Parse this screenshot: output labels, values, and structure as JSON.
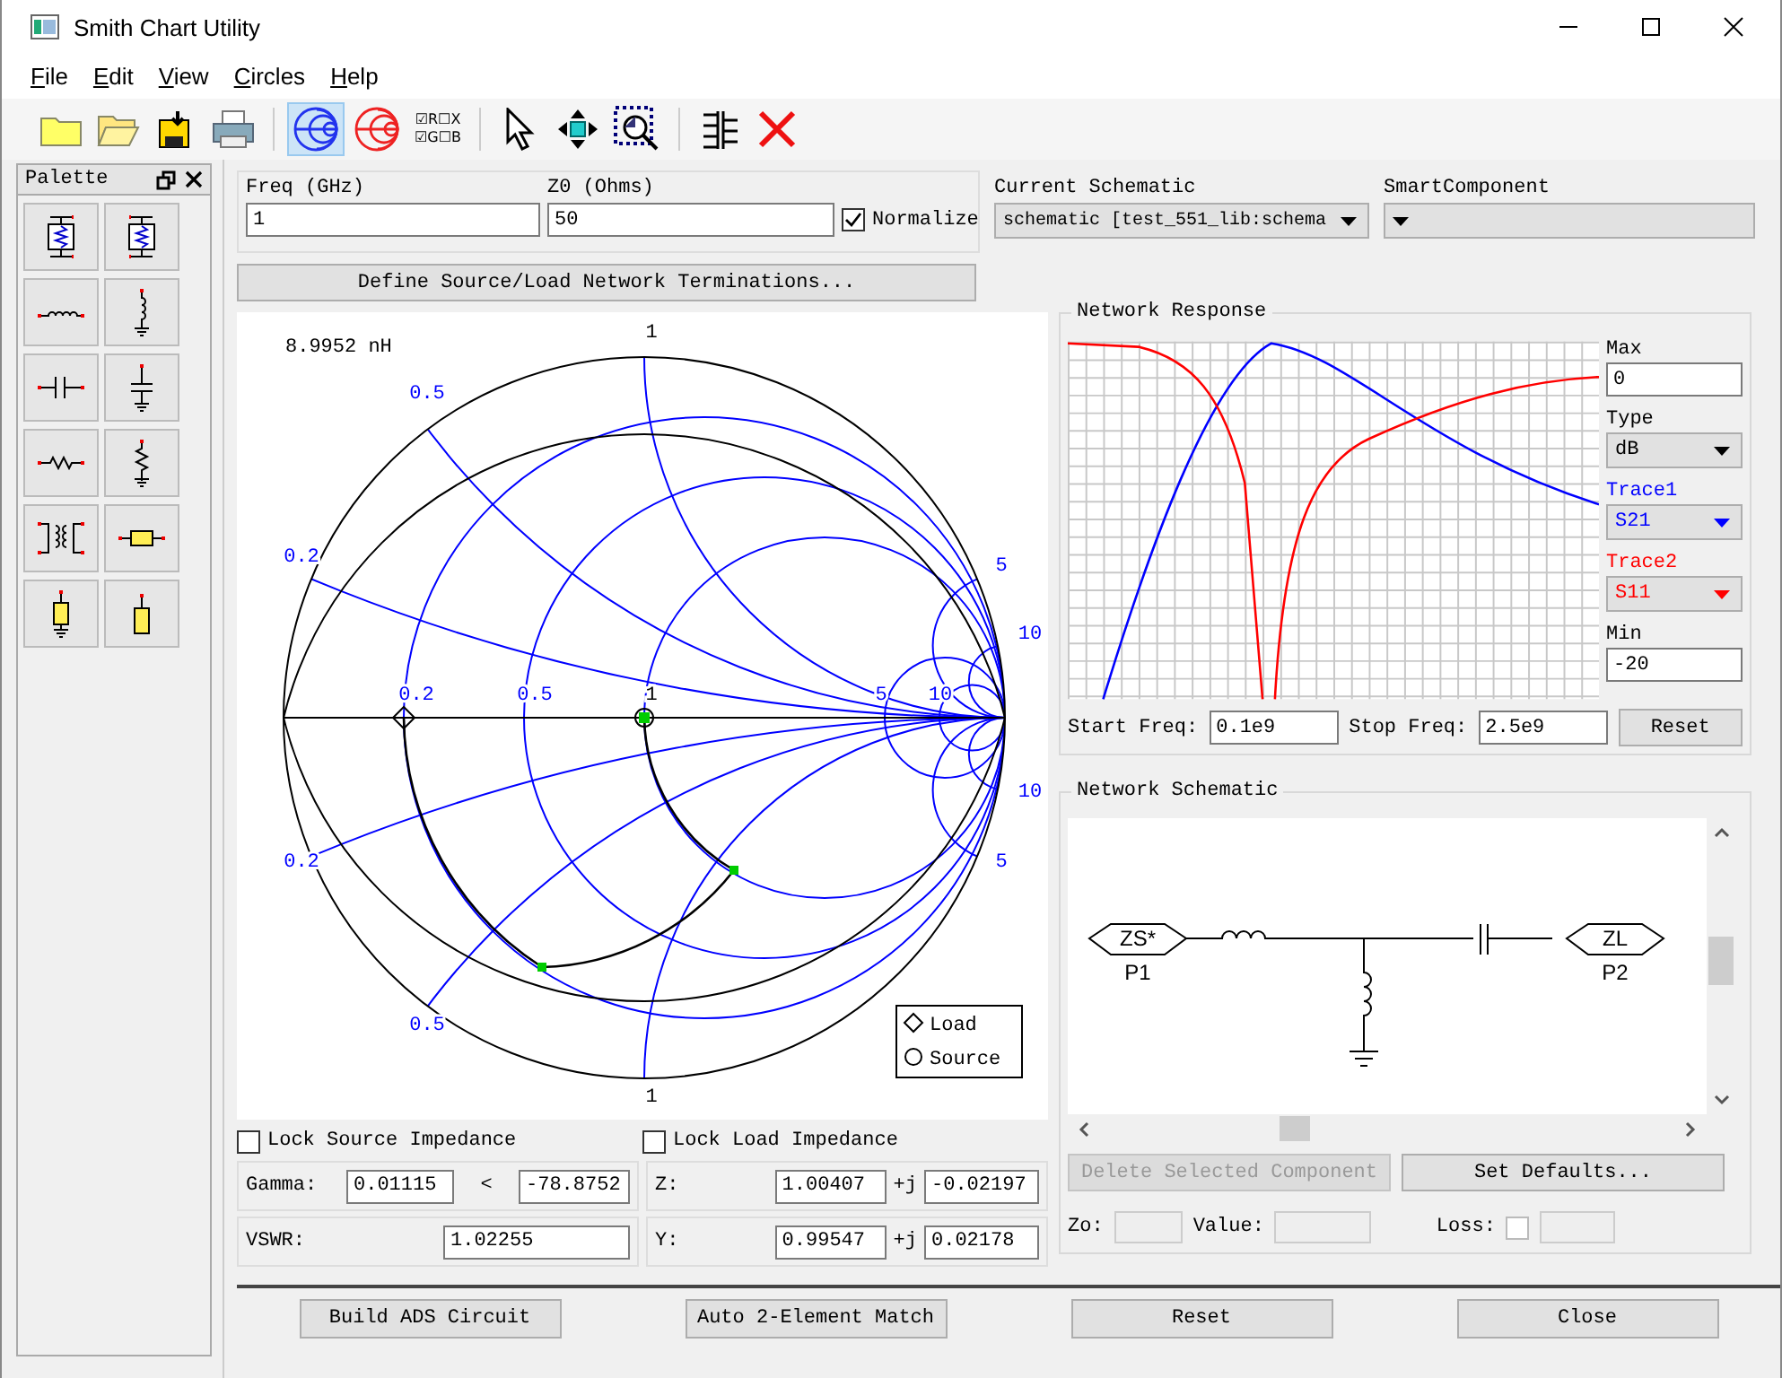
{
  "window": {
    "title": "Smith Chart Utility"
  },
  "menu": [
    "File",
    "Edit",
    "View",
    "Circles",
    "Help"
  ],
  "toolbar": [
    {
      "kind": "new",
      "selected": false
    },
    {
      "kind": "open",
      "selected": false
    },
    {
      "kind": "save",
      "selected": false
    },
    {
      "kind": "print",
      "selected": false
    },
    {
      "kind": "smithz",
      "selected": true
    },
    {
      "kind": "smithy",
      "selected": false
    },
    {
      "kind": "rxgb",
      "selected": false,
      "lines": [
        "☑R☐X",
        "☑G☐B"
      ]
    },
    {
      "kind": "pointer",
      "selected": false
    },
    {
      "kind": "pan",
      "selected": false
    },
    {
      "kind": "zoom",
      "selected": false
    },
    {
      "kind": "grid",
      "selected": false
    },
    {
      "kind": "delete",
      "selected": false
    }
  ],
  "palette": {
    "title": "Palette",
    "items": [
      {
        "kind": "twoport"
      },
      {
        "kind": "twoportb"
      },
      {
        "kind": "lser"
      },
      {
        "kind": "lsh"
      },
      {
        "kind": "cser"
      },
      {
        "kind": "csh"
      },
      {
        "kind": "rser"
      },
      {
        "kind": "rsh"
      },
      {
        "kind": "xfmr"
      },
      {
        "kind": "tline"
      },
      {
        "kind": "tlshort"
      },
      {
        "kind": "tlopen"
      }
    ]
  },
  "settings": {
    "freq": {
      "label": "Freq (GHz)",
      "value": "1"
    },
    "z0": {
      "label": "Z0 (Ohms)",
      "value": "50"
    },
    "normalize": {
      "label": "Normalize",
      "checked": true
    },
    "define_button": "Define Source/Load Network Terminations..."
  },
  "current_schematic": {
    "label": "Current Schematic",
    "value": "schematic [test_551_lib:schema"
  },
  "smart_component": {
    "label": "SmartComponent"
  },
  "smith_chart": {
    "readout": "8.9952 nH",
    "labels": [
      {
        "text": "1",
        "color": "#000000"
      },
      {
        "text": "0.5",
        "color": "#0000ff"
      },
      {
        "text": "0.2",
        "color": "#0000ff"
      },
      {
        "text": "0.2",
        "color": "#0000ff"
      },
      {
        "text": "0.5",
        "color": "#0000ff"
      },
      {
        "text": "1",
        "color": "#000000"
      },
      {
        "text": "5",
        "color": "#0000ff"
      },
      {
        "text": "10",
        "color": "#0000ff"
      },
      {
        "text": "5",
        "color": "#0000ff"
      },
      {
        "text": "10",
        "color": "#0000ff"
      },
      {
        "text": "10",
        "color": "#0000ff"
      },
      {
        "text": "5",
        "color": "#0000ff"
      },
      {
        "text": "0.2",
        "color": "#0000ff"
      },
      {
        "text": "0.5",
        "color": "#0000ff"
      },
      {
        "text": "1",
        "color": "#000000"
      }
    ],
    "legend": [
      {
        "kind": "load",
        "label": "Load"
      },
      {
        "kind": "source",
        "label": "Source"
      }
    ]
  },
  "lock_source": {
    "label": "Lock Source Impedance",
    "checked": false
  },
  "lock_load": {
    "label": "Lock Load Impedance",
    "checked": false
  },
  "gamma": {
    "label": "Gamma:",
    "magnitude": "0.01115",
    "angle_sign": "<",
    "angle": "-78.8752"
  },
  "z": {
    "label": "Z:",
    "real": "1.00407",
    "j": "+j",
    "imag": "-0.02197"
  },
  "vswr": {
    "label": "VSWR:",
    "value": "1.02255"
  },
  "y": {
    "label": "Y:",
    "real": "0.99547",
    "j": "+j",
    "imag": "0.02178"
  },
  "network_response": {
    "title": "Network Response",
    "max": {
      "label": "Max",
      "value": "0"
    },
    "type": {
      "label": "Type",
      "value": "dB"
    },
    "traces": [
      {
        "label": "Trace1",
        "value": "S21",
        "color": "#0000ff"
      },
      {
        "label": "Trace2",
        "value": "S11",
        "color": "#ff0000"
      }
    ],
    "min": {
      "label": "Min",
      "value": "-20"
    },
    "start_freq": {
      "label": "Start Freq:",
      "value": "0.1e9"
    },
    "stop_freq": {
      "label": "Stop Freq:",
      "value": "2.5e9"
    },
    "reset": "Reset"
  },
  "network_schematic": {
    "title": "Network Schematic",
    "ports": [
      {
        "name": "ZS*",
        "label": "P1"
      },
      {
        "name": "ZL",
        "label": "P2"
      }
    ],
    "delete_button": {
      "label": "Delete Selected Component",
      "disabled": true
    },
    "defaults_button": {
      "label": "Set Defaults...",
      "disabled": false
    },
    "zo_label": "Zo:",
    "value_label": "Value:",
    "loss": {
      "label": "Loss:",
      "checked": false
    }
  },
  "buttons": [
    "Build ADS Circuit",
    "Auto 2-Element Match",
    "Reset",
    "Close"
  ]
}
